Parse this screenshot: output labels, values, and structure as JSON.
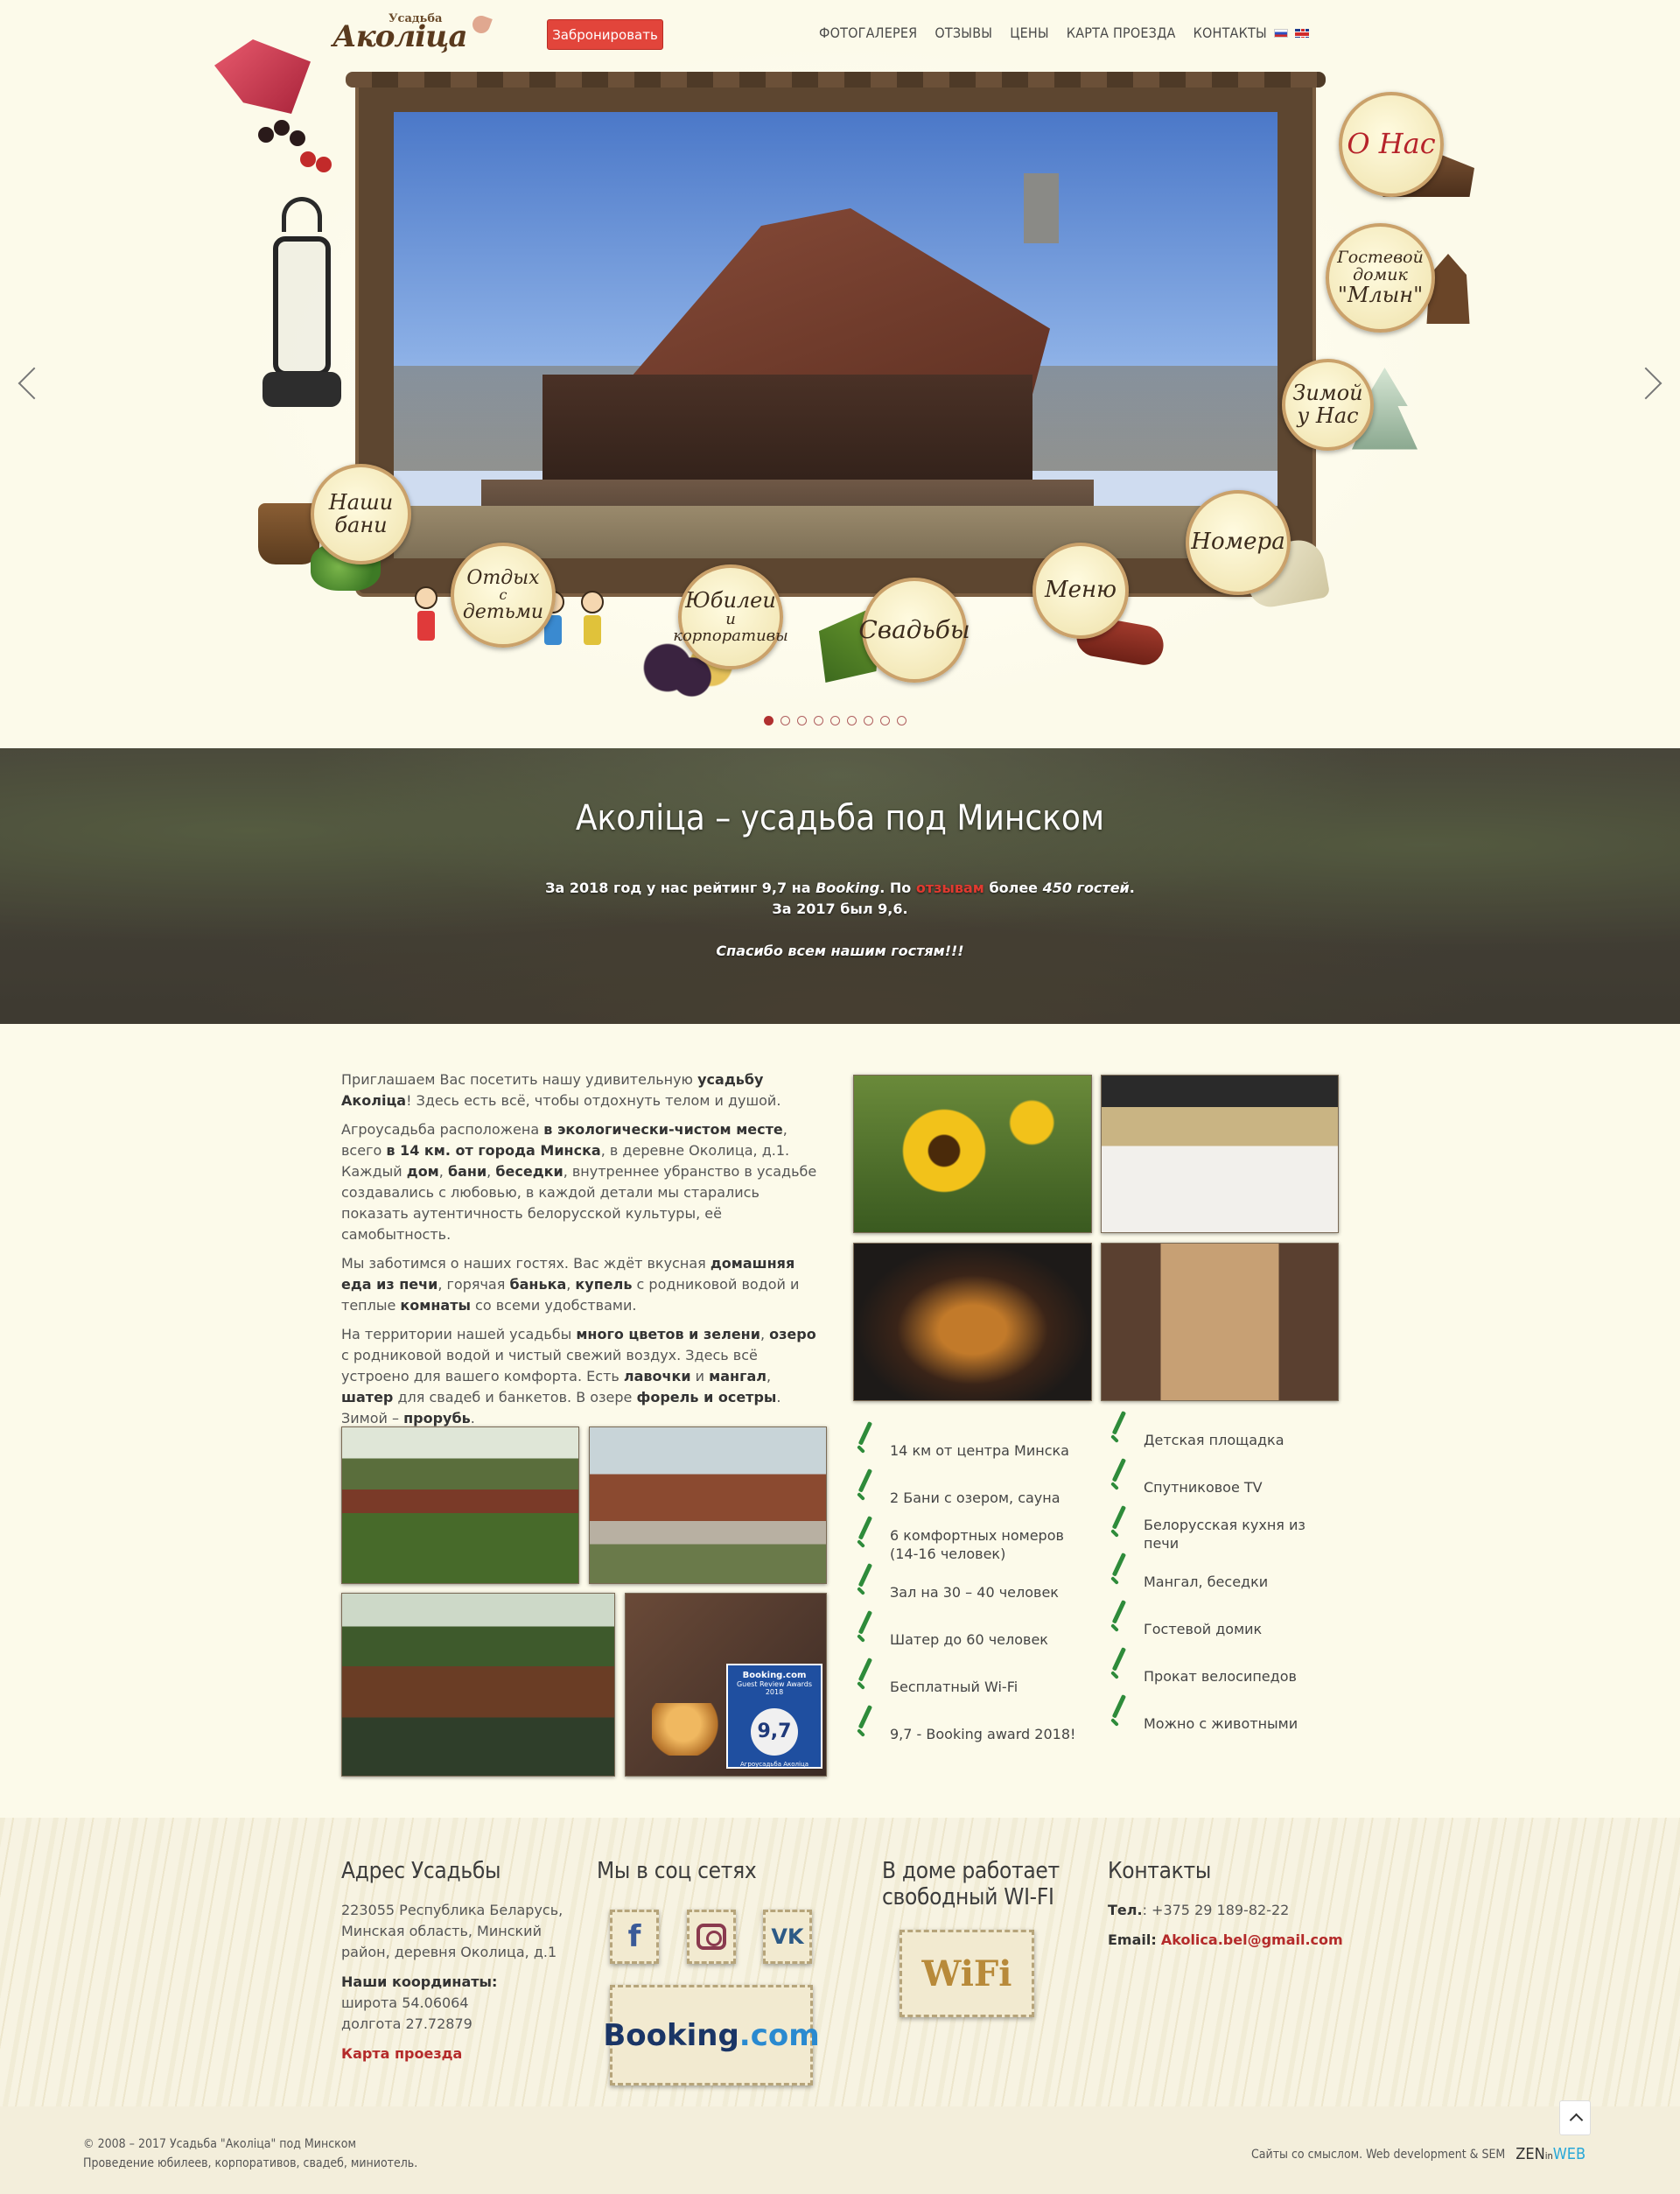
{
  "header": {
    "logo_small": "Усадьба",
    "logo_main": "Аколіца",
    "book_button": "Забронировать",
    "nav": [
      "ФОТОГАЛЕРЕЯ",
      "ОТЗЫВЫ",
      "ЦЕНЫ",
      "КАРТА ПРОЕЗДА",
      "КОНТАКТЫ"
    ],
    "languages": [
      "ru",
      "en"
    ]
  },
  "slider": {
    "bubbles": {
      "onas": "О Нас",
      "mlyn_1": "Гостевой",
      "mlyn_2": "домик",
      "mlyn_3": "\"Млын\"",
      "zima_1": "Зимой",
      "zima_2": "у Нас",
      "nomera": "Номера",
      "menu": "Меню",
      "svadby": "Свадьбы",
      "yubilei_1": "Юбилеи",
      "yubilei_2": "и",
      "yubilei_3": "корпоративы",
      "otdyh_1": "Отдых",
      "otdyh_2": "с",
      "otdyh_3": "детьми",
      "bani_1": "Наши",
      "bani_2": "бани"
    },
    "dots_total": 9,
    "active_dot": 0
  },
  "banner": {
    "title": "Аколіца – усадьба под Минском",
    "line1_a": "За 2018 год у нас рейтинг 9,7 на ",
    "line1_booking": "Booking",
    "line1_b": ". По ",
    "line1_reviews": "отзывам",
    "line1_c": " более ",
    "line1_guests": "450 гостей",
    "line1_d": ".",
    "line2": "За 2017 был 9,6.",
    "line3": "Спасибо всем нашим гостям!!!"
  },
  "intro": {
    "p1_a": "Приглашаем Вас посетить нашу удивительную ",
    "p1_b": "усадьбу Аколіца",
    "p1_c": "! Здесь есть всё, чтобы отдохнуть телом и душой.",
    "p2_a": "Агроусадьба расположена ",
    "p2_b": "в экологически-чистом месте",
    "p2_c": ", всего ",
    "p2_d": "в 14 км. от города Минска",
    "p2_e": ", в деревне Околица, д.1. Каждый ",
    "p2_f": "дом",
    "p2_g": ", ",
    "p2_h": "бани",
    "p2_i": ", ",
    "p2_j": "беседки",
    "p2_k": ", внутреннее убранство в усадьбе создавались с любовью, в каждой детали мы старались показать аутентичность белорусской культуры, её самобытность.",
    "p3_a": "Мы заботимся о наших гостях. Вас ждёт вкусная ",
    "p3_b": "домашняя еда из печи",
    "p3_c": ", горячая ",
    "p3_d": "банька",
    "p3_e": ", ",
    "p3_f": "купель",
    "p3_g": " с родниковой водой и теплые ",
    "p3_h": "комнаты",
    "p3_i": " со всеми удобствами.",
    "p4_a": "На территории нашей усадьбы ",
    "p4_b": "много цветов и зелени",
    "p4_c": ", ",
    "p4_d": "озеро",
    "p4_e": " с родниковой водой и чистый свежий воздух. Здесь всё устроено для вашего комфорта. Есть ",
    "p4_f": "лавочки",
    "p4_g": " и ",
    "p4_h": "мангал",
    "p4_i": ", ",
    "p4_j": "шатер",
    "p4_k": " для свадеб и банкетов. В озере ",
    "p4_l": "форель и осетры",
    "p4_m": ". Зимой – ",
    "p4_n": "прорубь",
    "p4_o": "."
  },
  "booking_photo": {
    "brand": "Booking.com",
    "caption": "Guest Review Awards 2018",
    "score": "9,7",
    "name": "Агроусадьба Аколіца"
  },
  "features_left": [
    "14 км от центра Минска",
    "2 Бани с озером, сауна",
    "6 комфортных номеров (14-16 человек)",
    "Зал на 30 – 40 человек",
    "Шатер до 60 человек",
    "Бесплатный Wi-Fi",
    "9,7 - Booking award 2018!"
  ],
  "features_right": [
    "Детская площадка",
    "Спутниковое TV",
    "Белорусская кухня из печи",
    "Мангал, беседки",
    "Гостевой домик",
    "Прокат велосипедов",
    "Можно с животными"
  ],
  "footer": {
    "address_title": "Адрес Усадьбы",
    "address_text": "223055 Республика Беларусь, Минская область, Минский район, деревня Околица, д.1",
    "coords_label": "Наши координаты:",
    "lat": "широта 54.06064",
    "lon": "долгота 27.72879",
    "map_link": "Карта проезда",
    "social_title": "Мы в соц сетях",
    "social": {
      "fb": "f",
      "vk": "VK",
      "booking_a": "Booking",
      "booking_b": ".com"
    },
    "wifi_title": "В доме работает свободный WI-FI",
    "wifi_stamp": "WiFi",
    "contacts_title": "Контакты",
    "tel_label": "Тел.",
    "tel": ": +375 29 189-82-22",
    "email_label": "Email:",
    "email": "Akolica.bel@gmail.com"
  },
  "bottom": {
    "copyright": "© 2008 – 2017 Усадьба \"Аколіца\" под Минском",
    "services": "Проведение юбилеев, корпоративов, свадеб, миниотель.",
    "credit": "Сайты со смыслом. Web development & SEM",
    "zen_a": "ZEN",
    "zen_b": "in",
    "zen_c": "WEB"
  },
  "colors": {
    "accent_red": "#e2453b",
    "link_red": "#b42a2a",
    "check_green": "#2e8b3a",
    "background": "#fcfaea"
  },
  "icons": [
    "facebook-icon",
    "instagram-icon",
    "vk-icon",
    "check-icon",
    "arrow-left-icon",
    "arrow-right-icon",
    "arrow-up-icon"
  ]
}
